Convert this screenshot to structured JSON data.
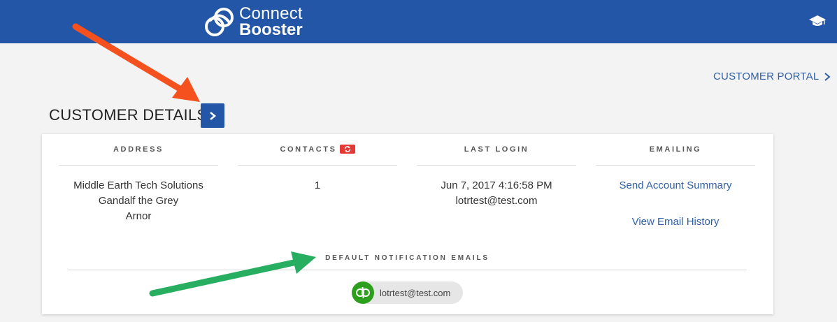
{
  "header": {
    "logo_line1": "Connect",
    "logo_line2": "Booster",
    "bg_color": "#2356a6"
  },
  "nav": {
    "portal_label": "CUSTOMER PORTAL"
  },
  "page": {
    "title": "CUSTOMER DETAILS"
  },
  "details": {
    "address": {
      "heading": "ADDRESS",
      "lines": [
        "Middle Earth Tech Solutions",
        "Gandalf the Grey",
        "Arnor"
      ]
    },
    "contacts": {
      "heading": "CONTACTS",
      "count": "1"
    },
    "last_login": {
      "heading": "LAST LOGIN",
      "datetime": "Jun 7, 2017 4:16:58 PM",
      "email": "lotrtest@test.com"
    },
    "emailing": {
      "heading": "EMAILING",
      "send_summary": "Send Account Summary",
      "view_history": "View Email History"
    }
  },
  "notifications": {
    "heading": "DEFAULT NOTIFICATION EMAILS",
    "emails": [
      {
        "address": "lotrtest@test.com",
        "icon": "quickbooks-icon",
        "icon_label": "qb"
      }
    ]
  },
  "colors": {
    "accent": "#2356a6",
    "link": "#2f5fa8",
    "sync_badge": "#e53935",
    "quickbooks": "#2ca01c",
    "orange_arrow": "#f4511e",
    "green_arrow": "#27ae60"
  }
}
